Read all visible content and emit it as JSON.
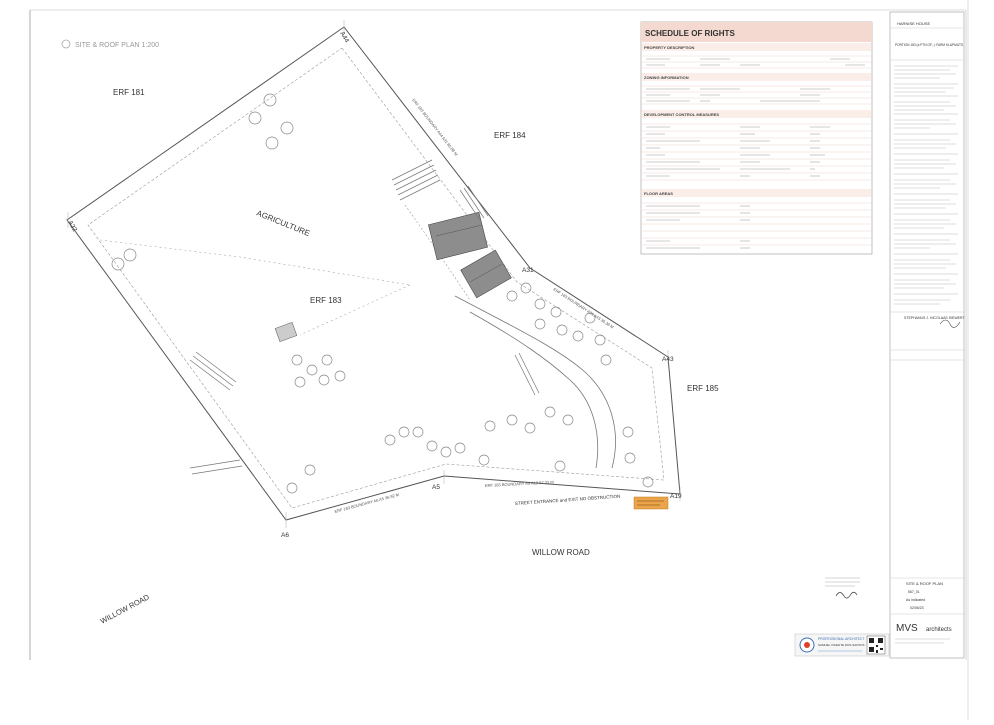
{
  "plan": {
    "title": "SITE & ROOF PLAN 1:200",
    "labels": {
      "erf181": "ERF 181",
      "erf184": "ERF 184",
      "erf183": "ERF 183",
      "erf185": "ERF 185",
      "agriculture": "AGRICULTURE",
      "willow_road_main": "WILLOW ROAD",
      "willow_road_side": "WILLOW ROAD",
      "street_entrance": "STREET ENTRANCE and EXIT NO OBSTRUCTION"
    },
    "points": {
      "a44": "A44",
      "a32": "A32",
      "a31": "A31",
      "a43": "A43",
      "a5": "A5",
      "a6": "A6",
      "a19": "A19"
    },
    "boundaries": {
      "top": "ERF 183 BOUNDARY A44 A31 86.88 M",
      "right": "ERF 183 BOUNDARY A31 A43 36.36 M",
      "bottom": "ERF 183 BOUNDARY A5 A19 57.33 M",
      "bottom_left": "ERF 183 BOUNDARY A6 A5 36.92 M"
    }
  },
  "schedule": {
    "title": "SCHEDULE OF RIGHTS",
    "sections": [
      "PROPERTY DESCRIPTION",
      "ZONING INFORMATION",
      "DEVELOPMENT CONTROL MEASURES",
      "FLOOR AREAS"
    ]
  },
  "title_block": {
    "project": "HARNISE HOUSE",
    "address": "PORTION 183 (a PTN OF...) FARM KLAPMUTS",
    "owner": "STEPHANUS J. NICOLAAS SIEWERT",
    "drawing_title": "SITE & ROOF PLAN",
    "drawing_no": "567_01",
    "scale": "As indicated",
    "date": "02/06/23",
    "firm": "architects",
    "firm_prefix": "MVS",
    "pro_arch_heading": "PROFESSIONAL ARCHITECT",
    "pro_arch_name": "SAMUEL VICENTE DOS SANTOS"
  },
  "colors": {
    "line": "#555555",
    "schedule_header": "#f3d9cf",
    "schedule_row": "#fbeee8",
    "notice": "#e9a44c",
    "roof": "#8d8d8d"
  }
}
